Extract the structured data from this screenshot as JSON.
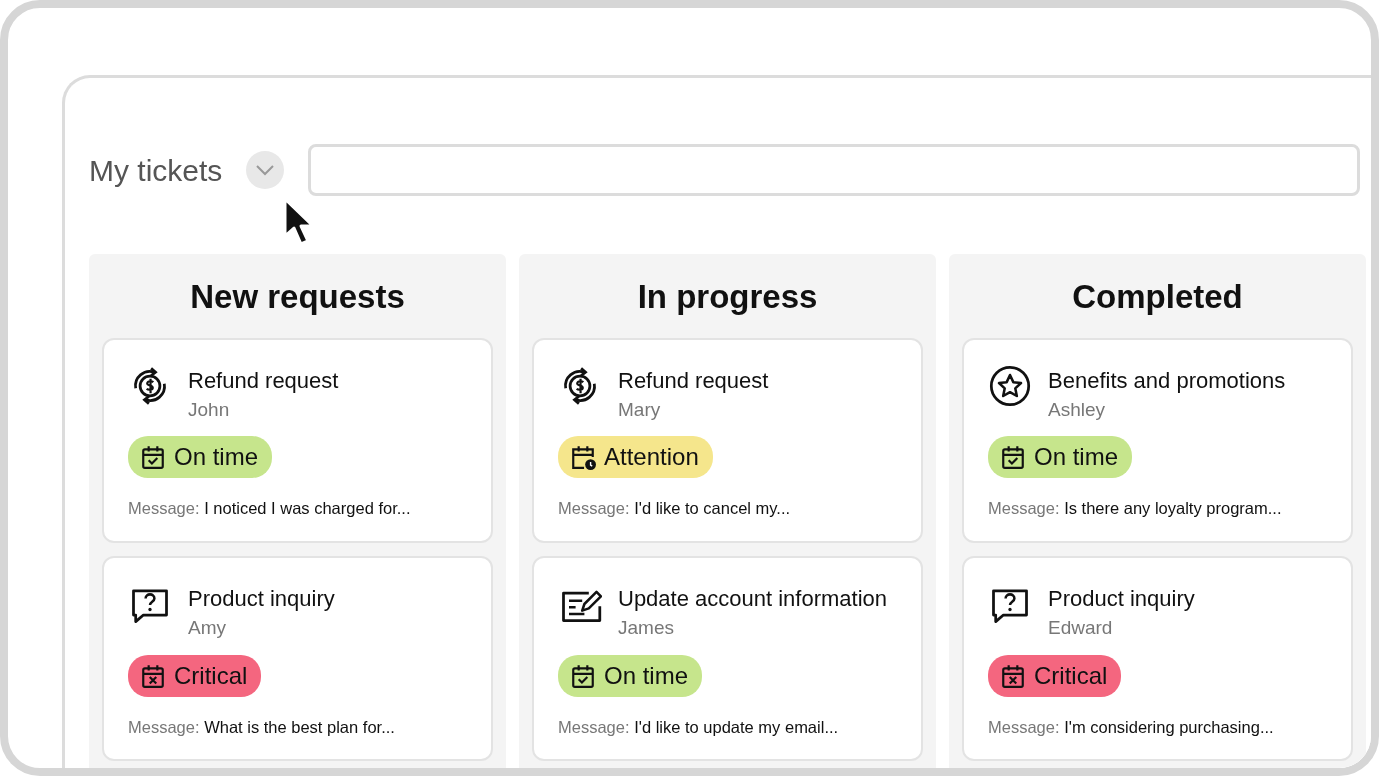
{
  "header": {
    "title": "My tickets"
  },
  "columns": [
    {
      "title": "New requests",
      "tickets": [
        {
          "kind": "refund",
          "title": "Refund request",
          "customer": "John",
          "status": {
            "kind": "on_time",
            "label": "On time",
            "color": "#c6e58c"
          },
          "message_label": "Message:",
          "message": "I noticed I was charged for..."
        },
        {
          "kind": "question",
          "title": "Product inquiry",
          "customer": "Amy",
          "status": {
            "kind": "critical",
            "label": "Critical",
            "color": "#f4667f"
          },
          "message_label": "Message:",
          "message": "What is the best plan for..."
        }
      ]
    },
    {
      "title": "In progress",
      "tickets": [
        {
          "kind": "refund",
          "title": "Refund request",
          "customer": "Mary",
          "status": {
            "kind": "attention",
            "label": "Attention",
            "color": "#f5e68c"
          },
          "message_label": "Message:",
          "message": "I'd like to cancel my..."
        },
        {
          "kind": "edit",
          "title": "Update account information",
          "customer": "James",
          "status": {
            "kind": "on_time",
            "label": "On time",
            "color": "#c6e58c"
          },
          "message_label": "Message:",
          "message": "I'd like to update my email..."
        }
      ]
    },
    {
      "title": "Completed",
      "tickets": [
        {
          "kind": "star",
          "title": "Benefits and promotions",
          "customer": "Ashley",
          "status": {
            "kind": "on_time",
            "label": "On time",
            "color": "#c6e58c"
          },
          "message_label": "Message:",
          "message": "Is there any loyalty program..."
        },
        {
          "kind": "question",
          "title": "Product inquiry",
          "customer": "Edward",
          "status": {
            "kind": "critical",
            "label": "Critical",
            "color": "#f4667f"
          },
          "message_label": "Message:",
          "message": "I'm considering purchasing..."
        }
      ]
    }
  ]
}
